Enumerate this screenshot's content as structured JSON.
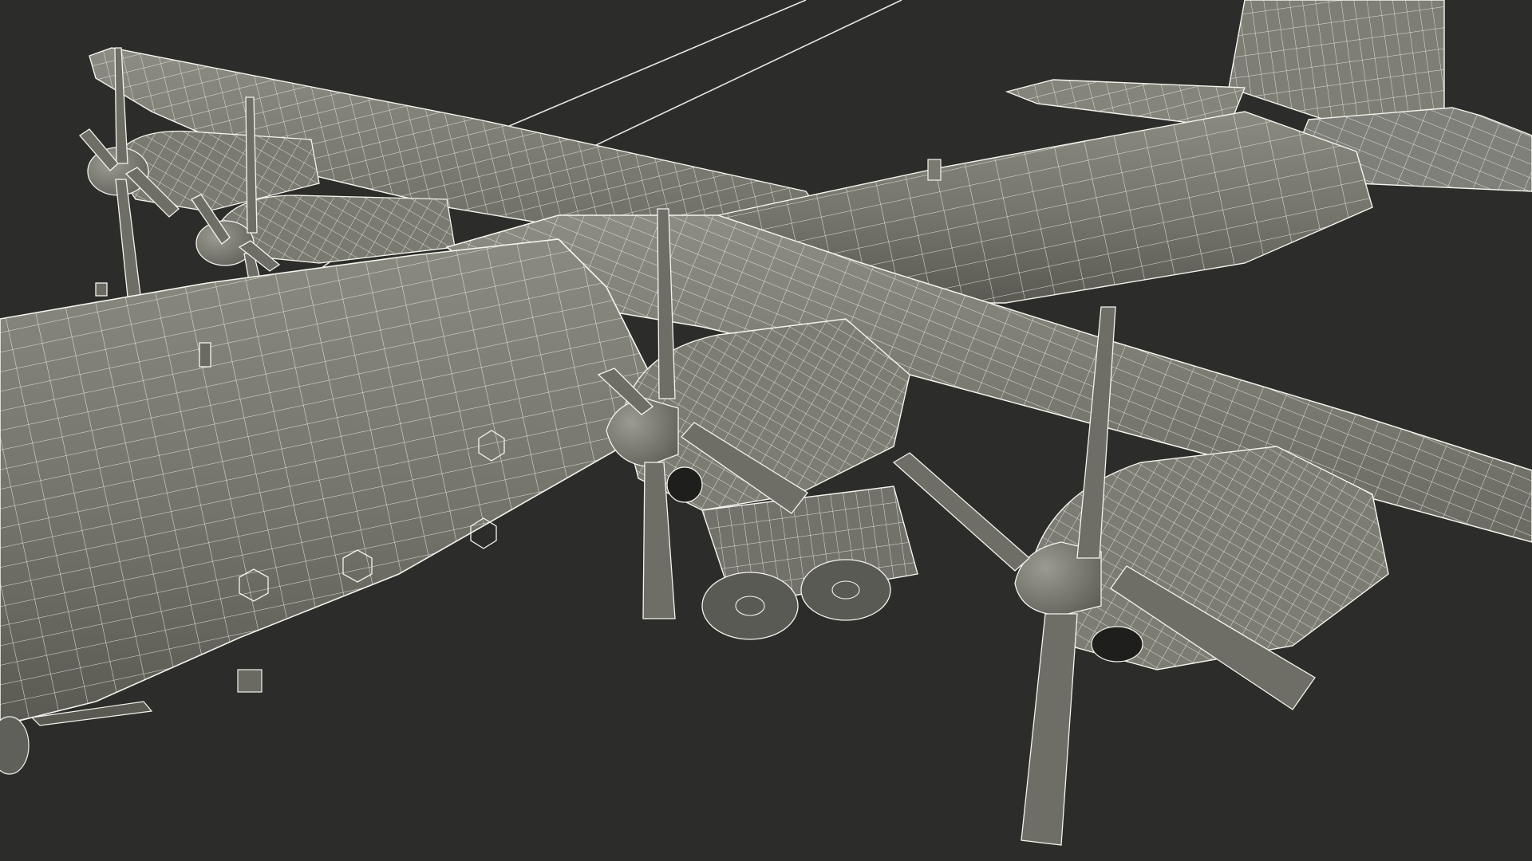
{
  "scene": {
    "subject": "cargo-aircraft-wireframe",
    "render_mode": "wireframe-shaded",
    "colors": {
      "background": "#2c2c2a",
      "surface": "#7a7a70",
      "surface_shadow": "#55554e",
      "surface_light": "#929288",
      "wire": "#f4f4ee"
    },
    "engines": 4,
    "propeller_blades_per_engine": 4
  }
}
